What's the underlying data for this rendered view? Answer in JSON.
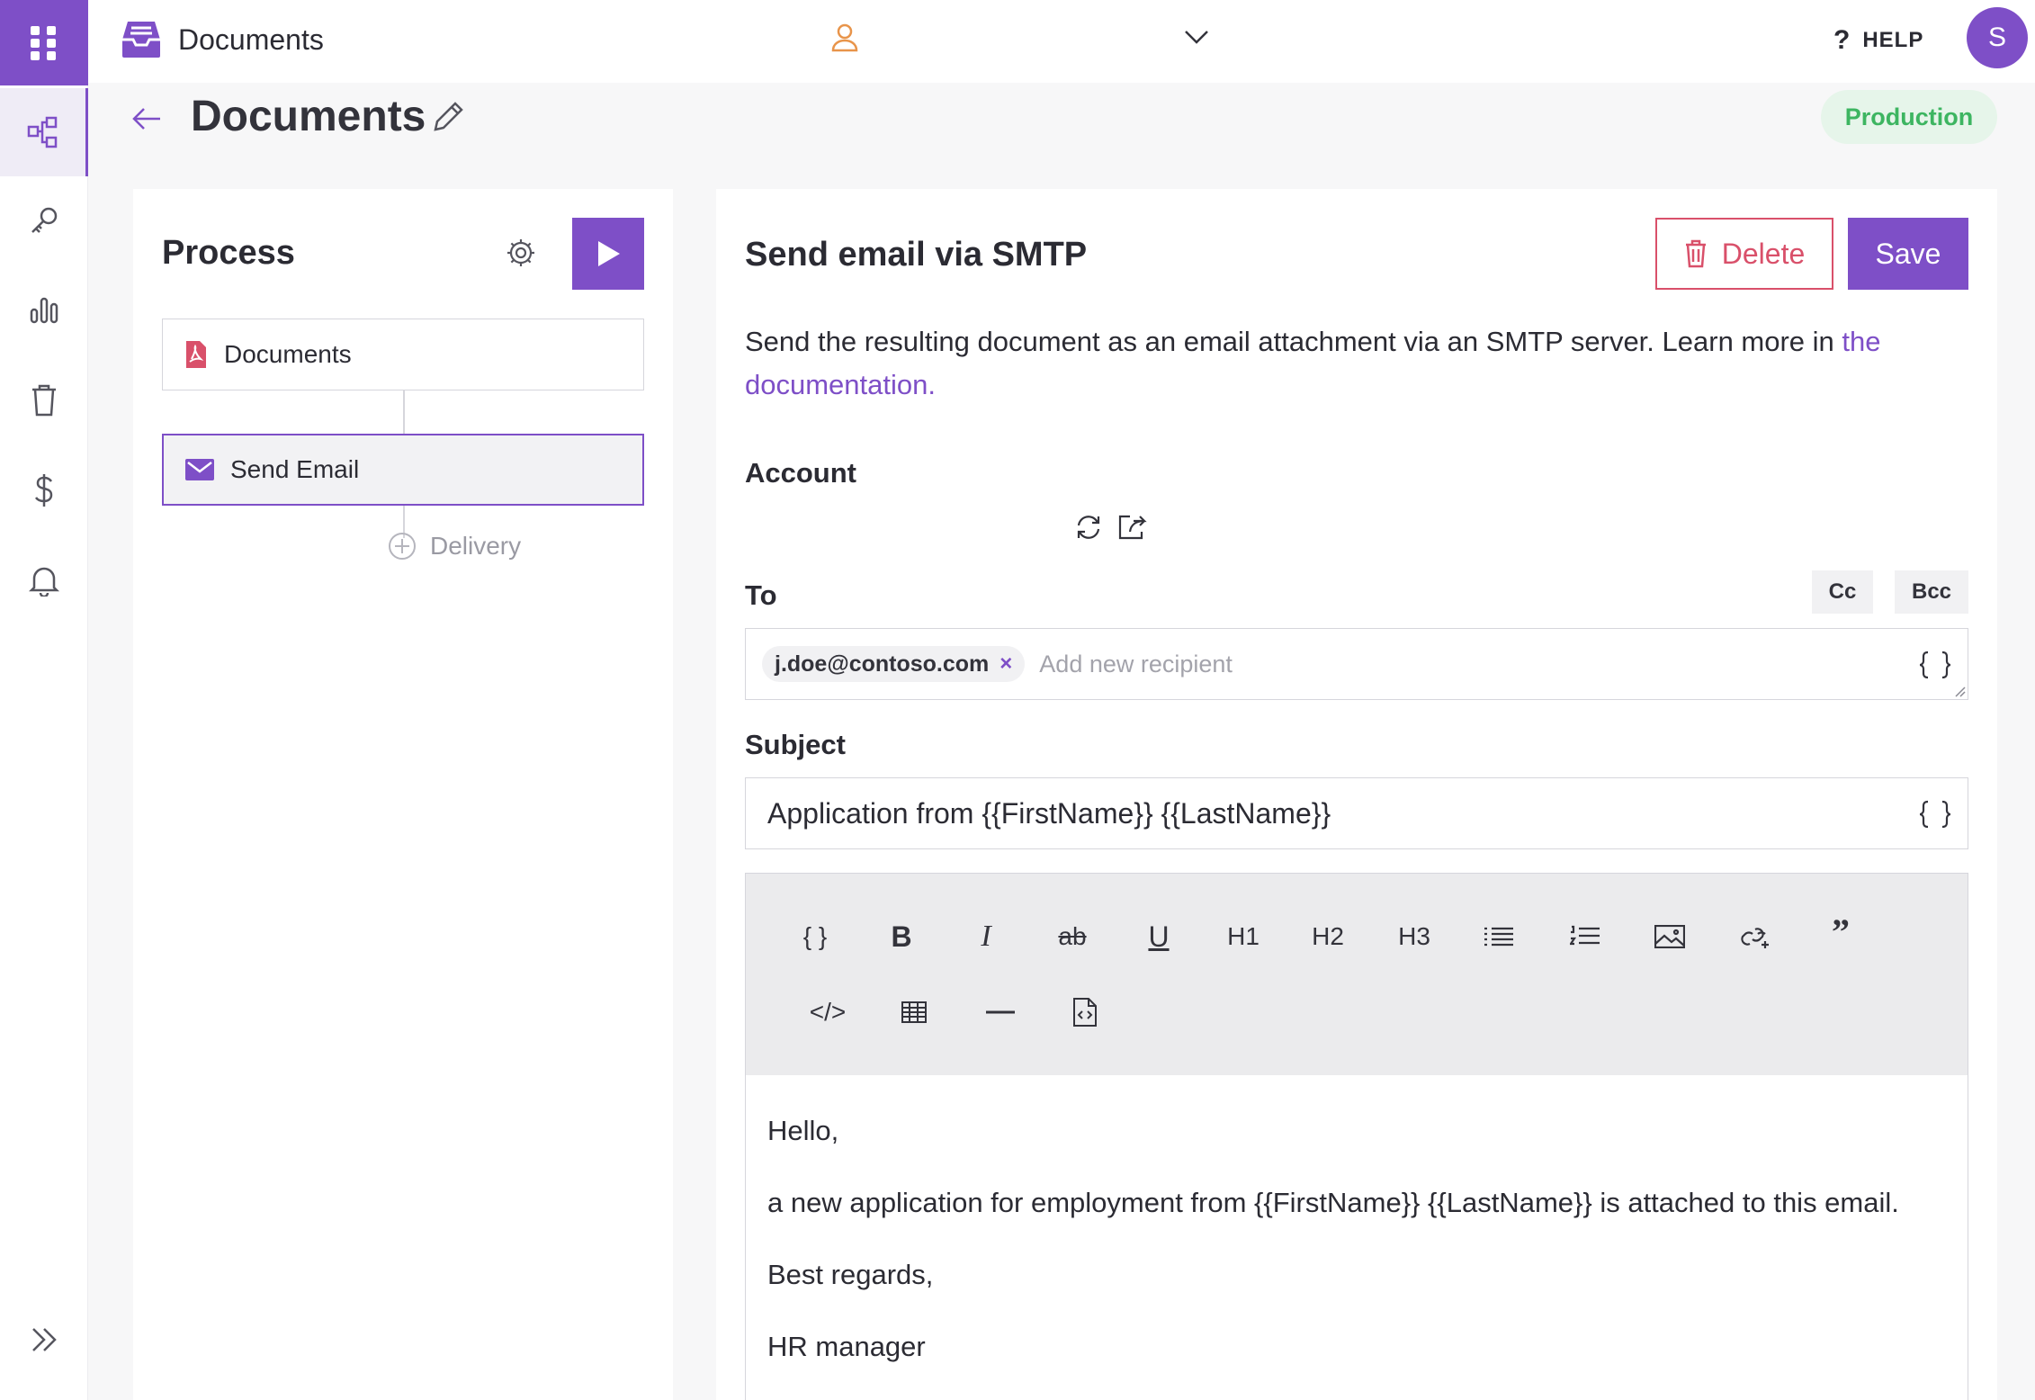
{
  "topbar": {
    "app_title": "Documents",
    "help_label": "HELP",
    "help_glyph": "?",
    "avatar_initial": "S"
  },
  "page": {
    "title": "Documents",
    "environment": "Production"
  },
  "process": {
    "title": "Process",
    "steps": [
      {
        "label": "Documents",
        "icon": "pdf-icon"
      },
      {
        "label": "Send Email",
        "icon": "mail-icon"
      }
    ],
    "add_label": "Delivery"
  },
  "editor": {
    "title": "Send email via SMTP",
    "delete_label": "Delete",
    "save_label": "Save",
    "description": "Send the resulting document as an email attachment via an SMTP server. Learn more in ",
    "description_link": "the documentation.",
    "account_label": "Account",
    "to_label": "To",
    "cc_label": "Cc",
    "bcc_label": "Bcc",
    "recipient_chip": "j.doe@contoso.com",
    "recipient_remove": "×",
    "recipient_placeholder": "Add new recipient",
    "subject_label": "Subject",
    "subject_value": "Application from {{FirstName}} {{LastName}}",
    "toolbar": {
      "bold": "B",
      "italic": "I",
      "strike": "ab",
      "underline": "U",
      "h1": "H1",
      "h2": "H2",
      "h3": "H3",
      "quote": "”",
      "code": "</>",
      "variable": "{ }"
    },
    "body": {
      "greeting": "Hello,",
      "line": "a new application for employment from {{FirstName}} {{LastName}} is attached to this email.",
      "closing": "Best regards,",
      "signature": "HR manager"
    }
  },
  "colors": {
    "accent": "#7e4fc7",
    "danger": "#d9506a",
    "success": "#3db561",
    "success_bg": "#e6f5ea"
  }
}
